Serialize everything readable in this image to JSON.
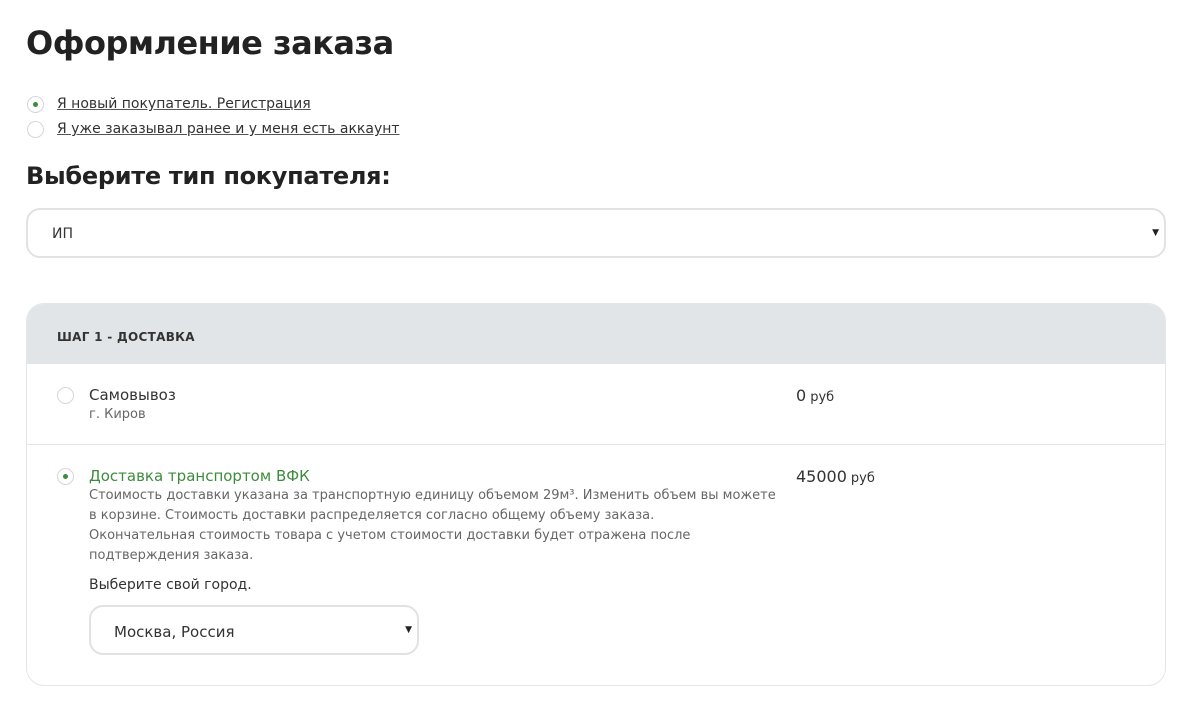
{
  "page": {
    "title": "Оформление заказа"
  },
  "account": {
    "options": [
      {
        "label": "Я новый покупатель. Регистрация",
        "checked": true
      },
      {
        "label": "Я уже заказывал ранее и у меня есть аккаунт",
        "checked": false
      }
    ]
  },
  "buyer_type": {
    "heading": "Выберите тип покупателя:",
    "selected": "ИП",
    "arrow_icon": "caret-down-icon"
  },
  "step1": {
    "title": "ШАГ 1 - ДОСТАВКА",
    "options": [
      {
        "name": "Самовывоз",
        "subtitle": "г. Киров",
        "price": "0",
        "currency": "руб",
        "checked": false
      },
      {
        "name": "Доставка транспортом ВФК",
        "description": [
          "Стоимость доставки указана за транспортную единицу объемом 29м³. Изменить объем вы можете",
          "в корзине. Стоимость доставки распределяется согласно общему объему заказа.",
          "Окончательная стоимость товара с учетом стоимости доставки будет отражена после",
          "подтверждения заказа."
        ],
        "price": "45000",
        "currency": "руб",
        "checked": true,
        "city_label": "Выберите свой город.",
        "city_selected": "Москва, Россия"
      }
    ]
  },
  "colors": {
    "accent_green": "#3d8b3d",
    "header_bg": "#e1e5e8",
    "border": "#e2e2e2"
  }
}
